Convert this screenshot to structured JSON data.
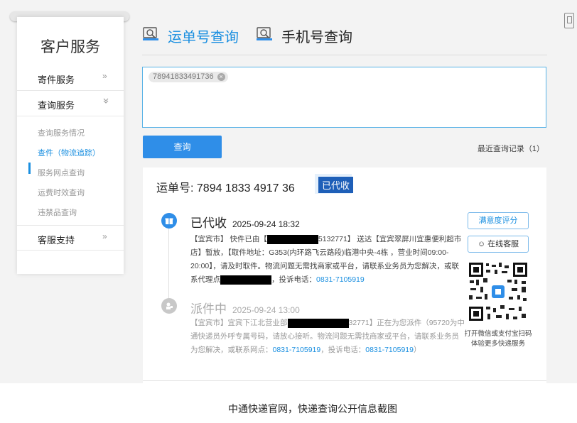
{
  "sidebar": {
    "title": "客户服务",
    "nav": [
      {
        "label": "寄件服务",
        "chevron": "»"
      },
      {
        "label": "查询服务",
        "chevron": "»"
      },
      {
        "label": "客服支持",
        "chevron": "»"
      }
    ],
    "sub_items": [
      {
        "label": "查询服务情况"
      },
      {
        "label": "查件（物流追踪）"
      },
      {
        "label": "服务网点查询"
      },
      {
        "label": "运费时效查询"
      },
      {
        "label": "违禁品查询"
      }
    ]
  },
  "tabs": [
    {
      "label": "运单号查询"
    },
    {
      "label": "手机号查询"
    }
  ],
  "query": {
    "chip_value": "78941833491736",
    "button_label": "查询",
    "history_link": "最近查询记录（1）"
  },
  "result": {
    "waybill_label": "运单号: 7894 1833 4917 36",
    "status_badge": "已代收",
    "events": [
      {
        "status": "已代收",
        "time": "2025-09-24 18:32",
        "text_a": "【宜宾市】 快件已由【",
        "text_b": "5132771】 送达【宜宾翠屏川宜惠便利超市店】暂放，【取件地址：G353(内环路飞云路段)临港中央-4栋 ，营业时间09:00-20:00】，请及时取件。物流问题无需找商家或平台，请联系业务员为您解决，或联系代理点",
        "text_c": "，投诉电话：",
        "phone": "0831-7105919"
      },
      {
        "status": "派件中",
        "time": "2025-09-24 13:00",
        "text_a": "【宜宾市】宜宾下江北营业部",
        "text_b": "32771】正在为您派件（95720为中通快递员外呼专属号码，请放心接听。物流问题无需找商家或平台，请联系业务员为您解决，或联系网点：",
        "phone_1": "0831-7105919",
        "text_c": "，投诉电话：",
        "phone_2": "0831-7105919",
        "text_d": "）"
      }
    ],
    "rate_button": "满意度评分",
    "chat_button": "在线客服",
    "qr_caption": "打开微信或支付宝扫码体验更多快递服务"
  },
  "caption": "中通快递官网，快递查询公开信息截图",
  "colors": {
    "accent": "#1a8fe0",
    "button": "#2f8ee8",
    "badge": "#1e5fb8"
  }
}
